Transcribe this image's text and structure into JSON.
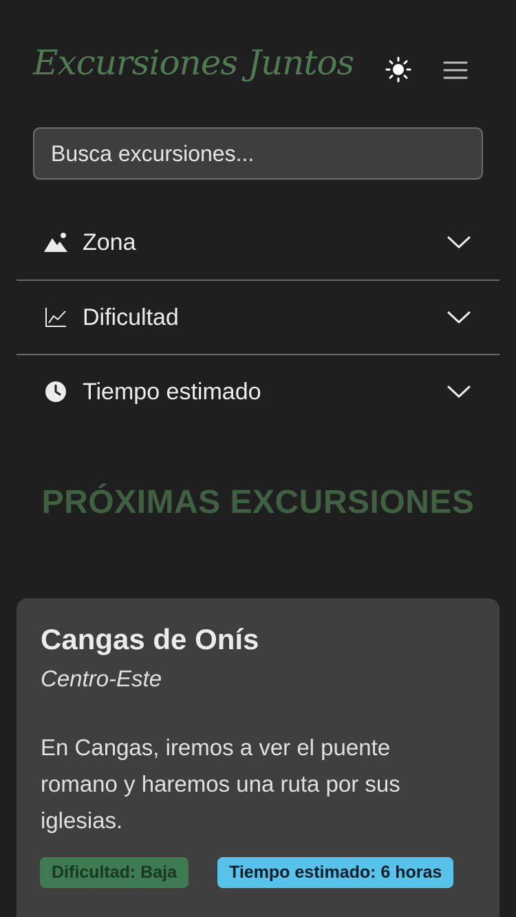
{
  "header": {
    "logo": "Excursiones Juntos",
    "theme_icon": "sun-icon",
    "menu_icon": "hamburger-menu-icon"
  },
  "search": {
    "placeholder": "Busca excursiones..."
  },
  "filters": [
    {
      "label": "Zona",
      "icon": "mountain-icon"
    },
    {
      "label": "Dificultad",
      "icon": "line-chart-icon"
    },
    {
      "label": "Tiempo estimado",
      "icon": "clock-icon"
    }
  ],
  "section": {
    "title": "PRÓXIMAS EXCURSIONES"
  },
  "excursions": [
    {
      "title": "Cangas de Onís",
      "zone": "Centro-Este",
      "description": "En Cangas, iremos a ver el puente romano y haremos una ruta por sus iglesias.",
      "difficulty_badge": "Dificultad: Baja",
      "time_badge": "Tiempo estimado: 6 horas"
    }
  ],
  "colors": {
    "background": "#1f1f1f",
    "brand_green": "#4f7a52",
    "card": "#3f3f3f",
    "badge_green": "#3e7a52",
    "badge_blue": "#58c3ea"
  }
}
